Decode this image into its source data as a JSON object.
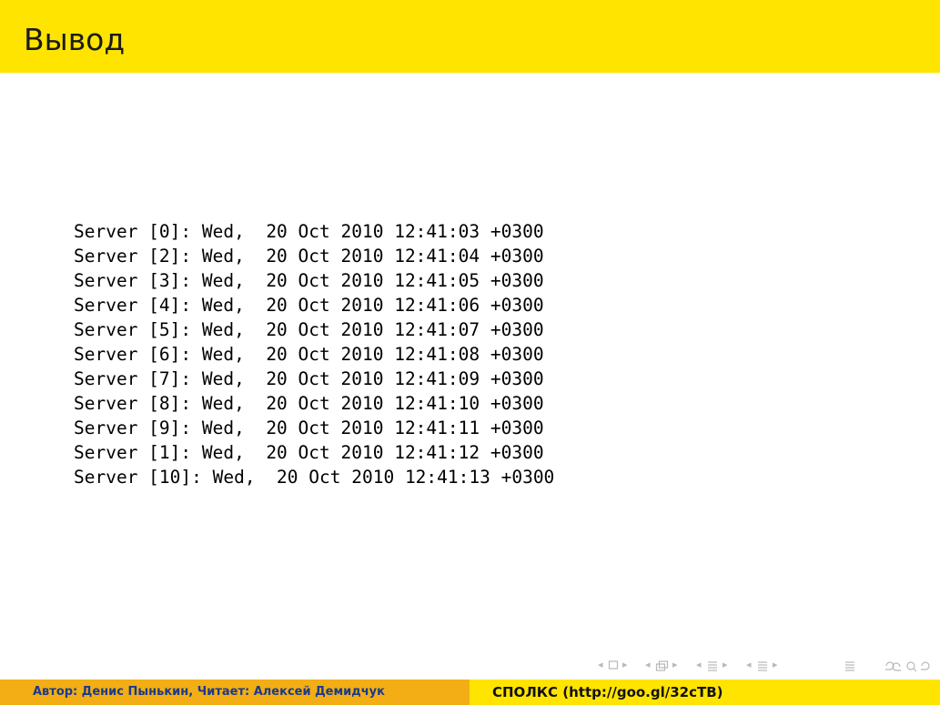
{
  "slide": {
    "title": "Вывод",
    "code_lines": [
      "Server [0]: Wed,  20 Oct 2010 12:41:03 +0300",
      "Server [2]: Wed,  20 Oct 2010 12:41:04 +0300",
      "Server [3]: Wed,  20 Oct 2010 12:41:05 +0300",
      "Server [4]: Wed,  20 Oct 2010 12:41:06 +0300",
      "Server [5]: Wed,  20 Oct 2010 12:41:07 +0300",
      "Server [6]: Wed,  20 Oct 2010 12:41:08 +0300",
      "Server [7]: Wed,  20 Oct 2010 12:41:09 +0300",
      "Server [8]: Wed,  20 Oct 2010 12:41:10 +0300",
      "Server [9]: Wed,  20 Oct 2010 12:41:11 +0300",
      "Server [1]: Wed,  20 Oct 2010 12:41:12 +0300",
      "Server [10]: Wed,  20 Oct 2010 12:41:13 +0300"
    ]
  },
  "footer": {
    "author": "Автор: Денис Пынькин, Читает: Алексей Демидчук",
    "course": "СПОЛКС (http://goo.gl/32cTB)"
  },
  "colors": {
    "title_bar": "#ffe400",
    "footer_left": "#f2ae14",
    "footer_right": "#ffe400",
    "footer_author_text": "#1a3a8e",
    "nav_symbols": "#b8b8b8"
  },
  "navigation": {
    "icons": [
      "prev-frame-icon",
      "frame-icon",
      "next-frame-icon",
      "prev-subsection-icon",
      "subsection-icon",
      "next-subsection-icon",
      "prev-section-icon",
      "section-icon",
      "next-section-icon",
      "align-icon",
      "search-icon"
    ]
  }
}
